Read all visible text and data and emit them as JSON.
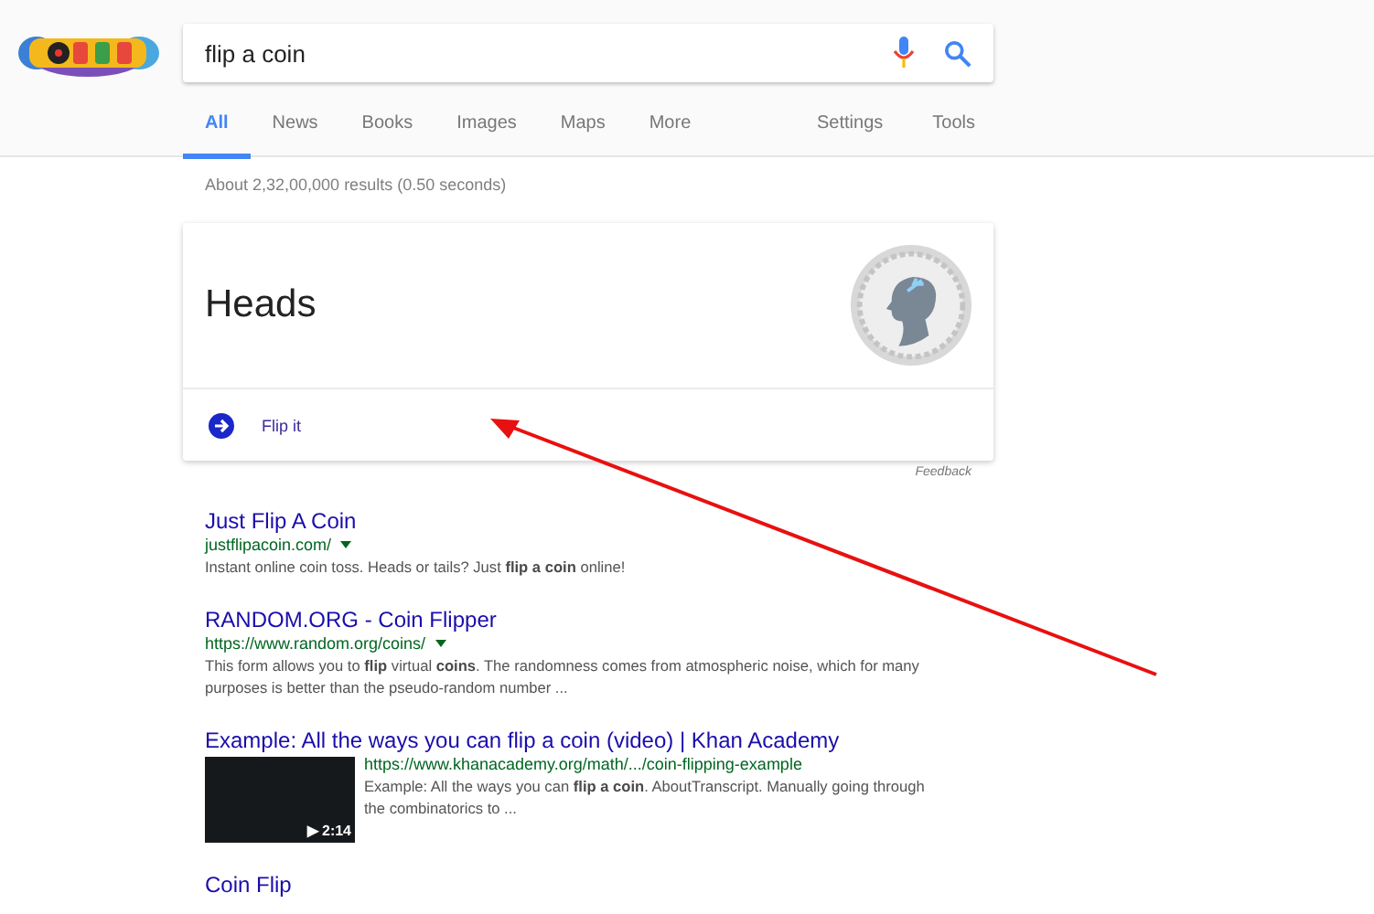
{
  "search": {
    "value": "flip a coin"
  },
  "tabs": [
    {
      "label": "All",
      "selected": true
    },
    {
      "label": "News",
      "selected": false
    },
    {
      "label": "Books",
      "selected": false
    },
    {
      "label": "Images",
      "selected": false
    },
    {
      "label": "Maps",
      "selected": false
    },
    {
      "label": "More",
      "selected": false
    }
  ],
  "tools": [
    "Settings",
    "Tools"
  ],
  "result_stats": "About 2,32,00,000 results (0.50 seconds)",
  "coin_card": {
    "result": "Heads",
    "action": "Flip it",
    "feedback": "Feedback"
  },
  "results": [
    {
      "kind": "web",
      "title": "Just Flip A Coin",
      "url": "justflipacoin.com/",
      "dropdown": true,
      "snippet": "Instant online coin toss. Heads or tails? Just **flip a coin** online!"
    },
    {
      "kind": "web",
      "title": "RANDOM.ORG - Coin Flipper",
      "url": "https://www.random.org/coins/",
      "dropdown": true,
      "snippet": "This form allows you to **flip** virtual **coins**. The randomness comes from atmospheric noise, which for many purposes is better than the pseudo-random number ..."
    },
    {
      "kind": "video",
      "title": "Example: All the ways you can flip a coin (video) | Khan Academy",
      "url": "https://www.khanacademy.org/math/.../coin-flipping-example",
      "dropdown": false,
      "duration": "▶ 2:14",
      "snippet": "Example: All the ways you can **flip a coin**. AboutTranscript. Manually going through the combinatorics to ..."
    },
    {
      "kind": "web",
      "title": "Coin Flip"
    }
  ]
}
